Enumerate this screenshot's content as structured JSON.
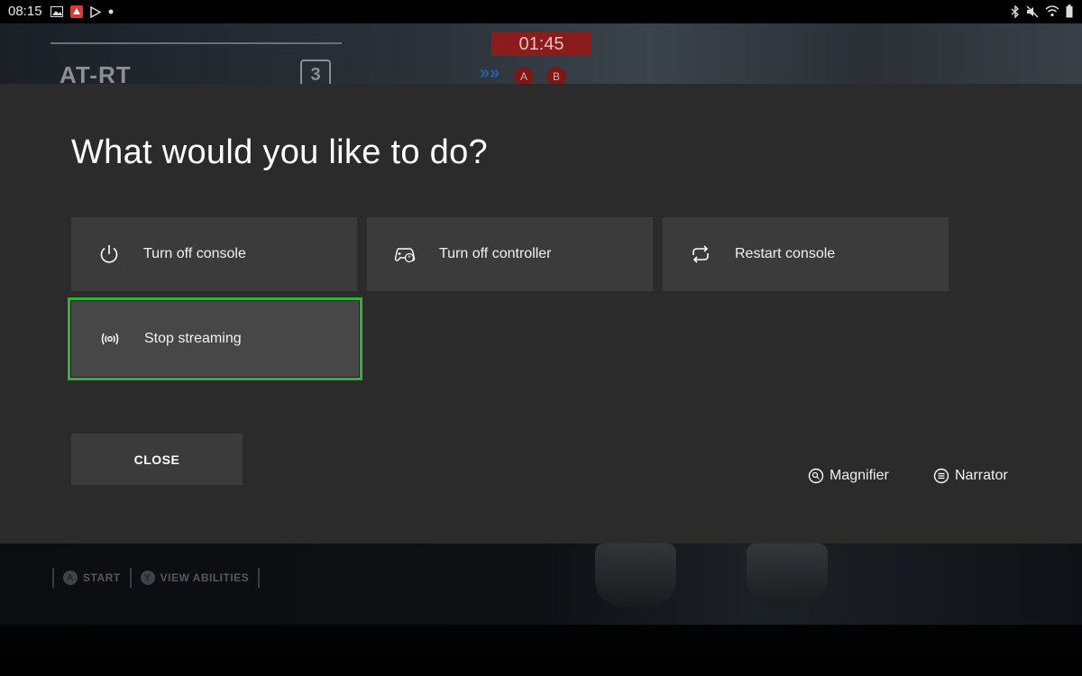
{
  "status_bar": {
    "time": "08:15",
    "notification_icons": [
      "image-icon",
      "app-notification-icon",
      "play-store-icon",
      "dot-icon"
    ],
    "system_icons": [
      "bluetooth-icon",
      "mute-icon",
      "wifi-icon",
      "battery-icon"
    ]
  },
  "game_hud": {
    "unit_name": "AT-RT",
    "unit_level": "3",
    "timer": "01:45",
    "objectives": [
      "A",
      "B"
    ],
    "hints": [
      {
        "button": "A",
        "label": "START"
      },
      {
        "button": "Y",
        "label": "VIEW ABILITIES"
      }
    ]
  },
  "dialog": {
    "title": "What would you like to do?",
    "options": [
      {
        "label": "Turn off console",
        "icon": "power-icon"
      },
      {
        "label": "Turn off controller",
        "icon": "controller-power-icon"
      },
      {
        "label": "Restart console",
        "icon": "restart-icon"
      },
      {
        "label": "Stop streaming",
        "icon": "streaming-icon",
        "focused": true
      }
    ],
    "close_label": "CLOSE",
    "accessibility": [
      {
        "label": "Magnifier",
        "icon": "magnifier-icon"
      },
      {
        "label": "Narrator",
        "icon": "narrator-icon"
      }
    ],
    "focus_color": "#30b33a"
  }
}
